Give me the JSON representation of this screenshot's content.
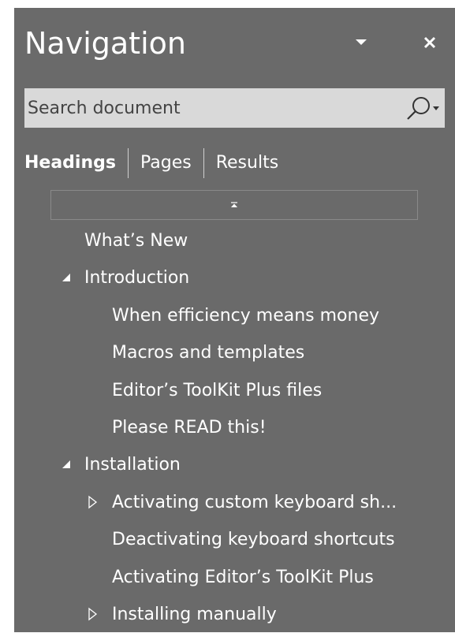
{
  "pane": {
    "title": "Navigation",
    "colors": {
      "background": "#6a6a6a",
      "text": "#ffffff",
      "search_bg": "#d9d9d9"
    }
  },
  "search": {
    "placeholder": "Search document",
    "value": ""
  },
  "tabs": [
    {
      "label": "Headings",
      "active": true
    },
    {
      "label": "Pages",
      "active": false
    },
    {
      "label": "Results",
      "active": false
    }
  ],
  "tree": [
    {
      "label": "What’s New",
      "level": 1,
      "toggle": "none"
    },
    {
      "label": "Introduction",
      "level": 1,
      "toggle": "expanded"
    },
    {
      "label": "When efficiency means money",
      "level": 2,
      "toggle": "none"
    },
    {
      "label": "Macros and templates",
      "level": 2,
      "toggle": "none"
    },
    {
      "label": "Editor’s ToolKit Plus files",
      "level": 2,
      "toggle": "none"
    },
    {
      "label": "Please READ this!",
      "level": 2,
      "toggle": "none"
    },
    {
      "label": "Installation",
      "level": 1,
      "toggle": "expanded"
    },
    {
      "label": "Activating custom keyboard sh...",
      "level": 2,
      "toggle": "collapsed"
    },
    {
      "label": "Deactivating keyboard shortcuts",
      "level": 2,
      "toggle": "none"
    },
    {
      "label": "Activating Editor’s ToolKit Plus",
      "level": 2,
      "toggle": "none"
    },
    {
      "label": "Installing manually",
      "level": 2,
      "toggle": "collapsed"
    }
  ],
  "icons": {
    "dropdown": "chevron-down-icon",
    "close": "close-icon",
    "search": "search-icon",
    "collapse_all": "collapse-up-icon",
    "expanded": "triangle-expanded-icon",
    "collapsed": "triangle-collapsed-icon"
  }
}
